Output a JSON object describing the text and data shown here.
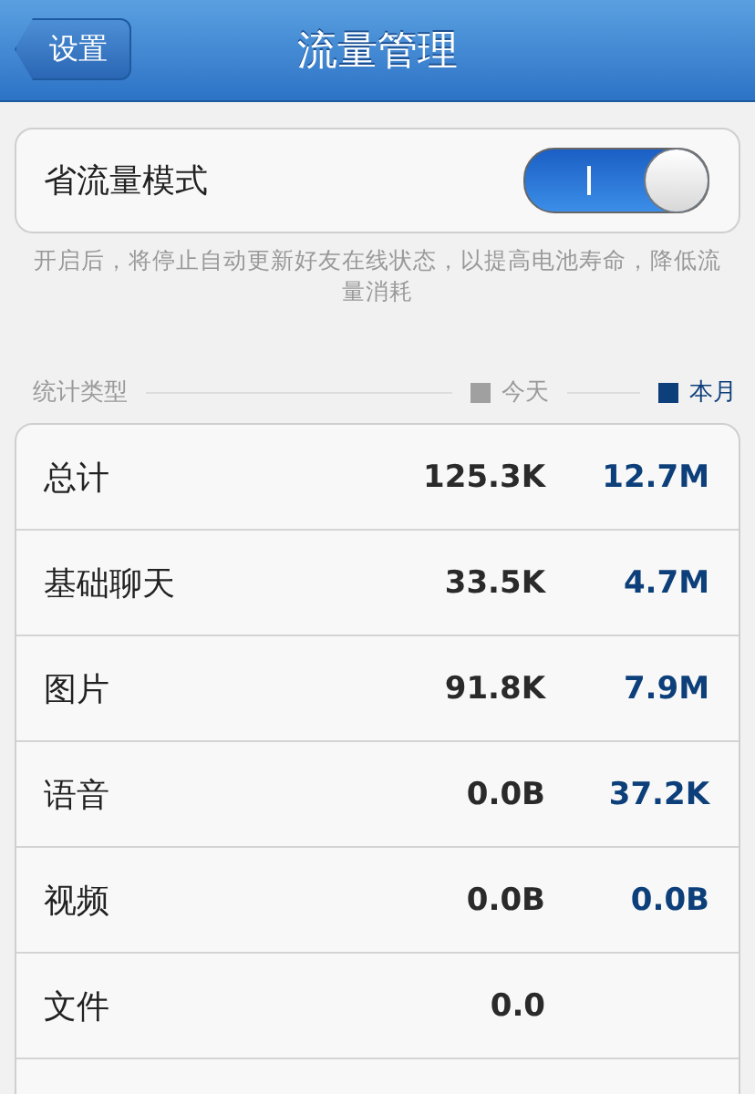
{
  "nav": {
    "back": "设置",
    "title": "流量管理"
  },
  "saver": {
    "label": "省流量模式",
    "on": true,
    "note": "开启后，将停止自动更新好友在线状态，以提高电池寿命，降低流量消耗"
  },
  "stats": {
    "title": "统计类型",
    "legend": [
      {
        "label": "今天",
        "color": "#a0a0a0"
      },
      {
        "label": "本月",
        "color": "#0d3f7a"
      }
    ],
    "rows": [
      {
        "name": "总计",
        "today": "125.3K",
        "month": "12.7M"
      },
      {
        "name": "基础聊天",
        "today": "33.5K",
        "month": "4.7M"
      },
      {
        "name": "图片",
        "today": "91.8K",
        "month": "7.9M"
      },
      {
        "name": "语音",
        "today": "0.0B",
        "month": "37.2K"
      },
      {
        "name": "视频",
        "today": "0.0B",
        "month": "0.0B"
      },
      {
        "name": "文件",
        "today": "0.0"
      }
    ]
  }
}
